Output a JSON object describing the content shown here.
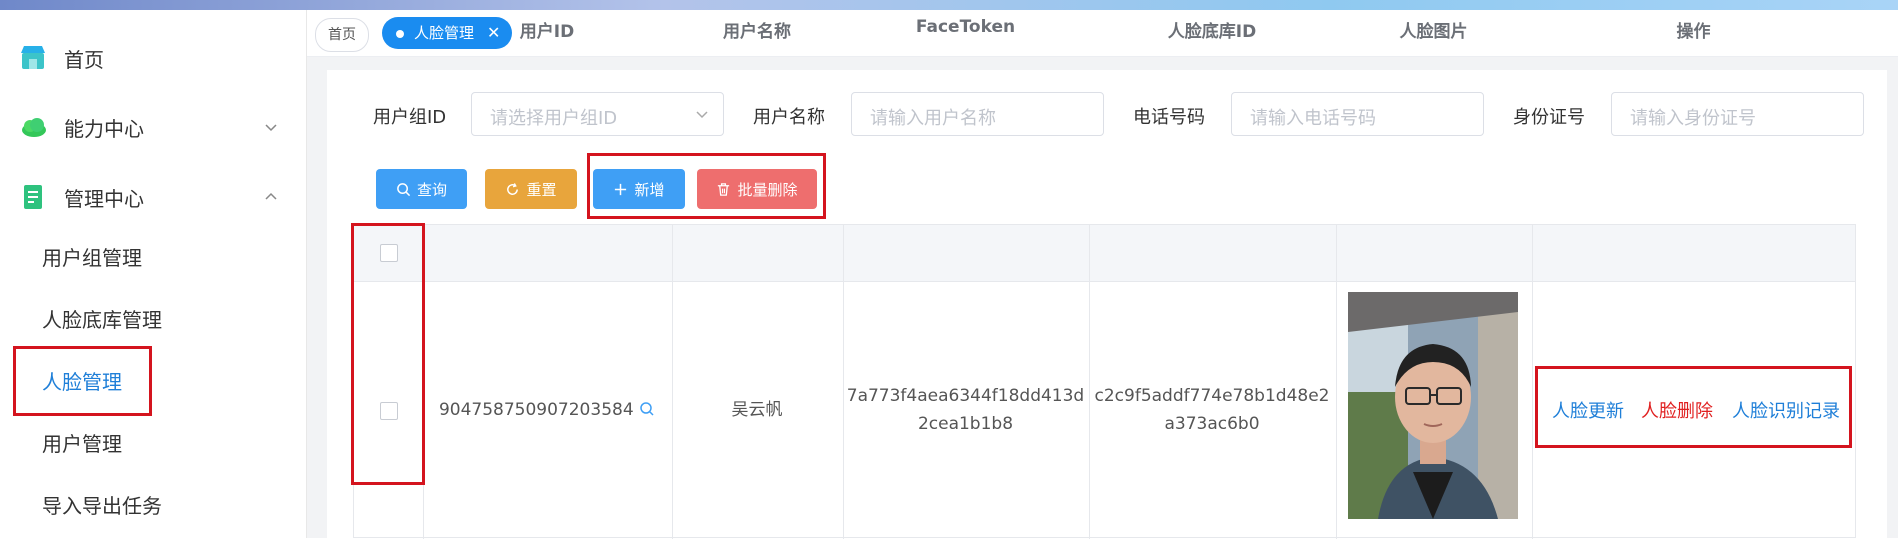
{
  "sidebar": {
    "items": [
      {
        "label": "首页",
        "icon": "store-icon"
      },
      {
        "label": "能力中心",
        "icon": "cloud-icon"
      },
      {
        "label": "管理中心",
        "icon": "document-icon"
      }
    ],
    "sub_items": [
      {
        "label": "用户组管理"
      },
      {
        "label": "人脸底库管理"
      },
      {
        "label": "人脸管理",
        "active": true
      },
      {
        "label": "用户管理"
      },
      {
        "label": "导入导出任务"
      }
    ]
  },
  "tabs": {
    "home": "首页",
    "active": "人脸管理",
    "close": "✕"
  },
  "filters": {
    "group_id_label": "用户组ID",
    "group_id_placeholder": "请选择用户组ID",
    "username_label": "用户名称",
    "username_placeholder": "请输入用户名称",
    "phone_label": "电话号码",
    "phone_placeholder": "请输入电话号码",
    "idcard_label": "身份证号",
    "idcard_placeholder": "请输入身份证号"
  },
  "toolbar": {
    "query": "查询",
    "reset": "重置",
    "add": "新增",
    "batch_delete": "批量删除"
  },
  "table": {
    "columns": [
      "用户ID",
      "用户名称",
      "FaceToken",
      "人脸底库ID",
      "人脸图片",
      "操作"
    ],
    "rows": [
      {
        "user_id": "904758750907203584",
        "username": "吴云帆",
        "face_token_1": "7a773f4aea6344f18dd413d",
        "face_token_2": "2cea1b1b8",
        "library_id_1": "c2c9f5addf774e78b1d48e2",
        "library_id_2": "a373ac6b0",
        "actions": {
          "update": "人脸更新",
          "delete": "人脸删除",
          "records": "人脸识别记录"
        }
      }
    ]
  },
  "colors": {
    "primary": "#3f9ff5",
    "warning": "#e8a53c",
    "danger": "#ee6e6e",
    "link": "#1f7fd8",
    "link_danger": "#e02020",
    "highlight_box": "#d4141e"
  }
}
